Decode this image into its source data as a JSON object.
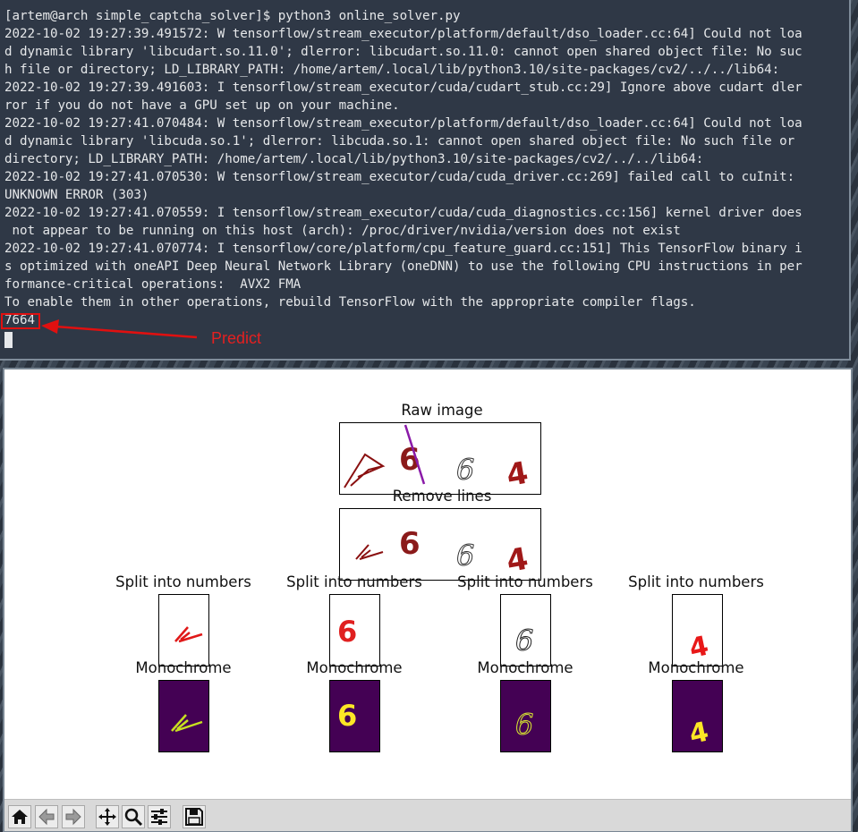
{
  "terminal": {
    "lines": [
      "[artem@arch simple_captcha_solver]$ python3 online_solver.py",
      "2022-10-02 19:27:39.491572: W tensorflow/stream_executor/platform/default/dso_loader.cc:64] Could not loa",
      "d dynamic library 'libcudart.so.11.0'; dlerror: libcudart.so.11.0: cannot open shared object file: No suc",
      "h file or directory; LD_LIBRARY_PATH: /home/artem/.local/lib/python3.10/site-packages/cv2/../../lib64:",
      "2022-10-02 19:27:39.491603: I tensorflow/stream_executor/cuda/cudart_stub.cc:29] Ignore above cudart dler",
      "ror if you do not have a GPU set up on your machine.",
      "2022-10-02 19:27:41.070484: W tensorflow/stream_executor/platform/default/dso_loader.cc:64] Could not loa",
      "d dynamic library 'libcuda.so.1'; dlerror: libcuda.so.1: cannot open shared object file: No such file or",
      "directory; LD_LIBRARY_PATH: /home/artem/.local/lib/python3.10/site-packages/cv2/../../lib64:",
      "2022-10-02 19:27:41.070530: W tensorflow/stream_executor/cuda/cuda_driver.cc:269] failed call to cuInit:",
      "UNKNOWN ERROR (303)",
      "2022-10-02 19:27:41.070559: I tensorflow/stream_executor/cuda/cuda_diagnostics.cc:156] kernel driver does",
      " not appear to be running on this host (arch): /proc/driver/nvidia/version does not exist",
      "2022-10-02 19:27:41.070774: I tensorflow/core/platform/cpu_feature_guard.cc:151] This TensorFlow binary i",
      "s optimized with oneAPI Deep Neural Network Library (oneDNN) to use the following CPU instructions in per",
      "formance-critical operations:  AVX2 FMA",
      "To enable them in other operations, rebuild TensorFlow with the appropriate compiler flags.",
      "7664"
    ],
    "annotation_label": "Predict",
    "annotation_color": "#e42020"
  },
  "figure": {
    "raw_title": "Raw image",
    "lines_title": "Remove lines",
    "split_titles": [
      "Split into numbers",
      "Split into numbers",
      "Split into numbers",
      "Split into numbers"
    ],
    "mono_titles": [
      "Monochrome",
      "Monochrome",
      "Monochrome",
      "Monochrome"
    ],
    "digits": [
      "7",
      "6",
      "6",
      "4"
    ],
    "mono_bg": "#440154",
    "mono_fg": "#fde725"
  },
  "toolbar": {
    "buttons": [
      "home-icon",
      "back-icon",
      "forward-icon",
      "pan-icon",
      "zoom-icon",
      "configure-icon",
      "save-icon"
    ]
  }
}
